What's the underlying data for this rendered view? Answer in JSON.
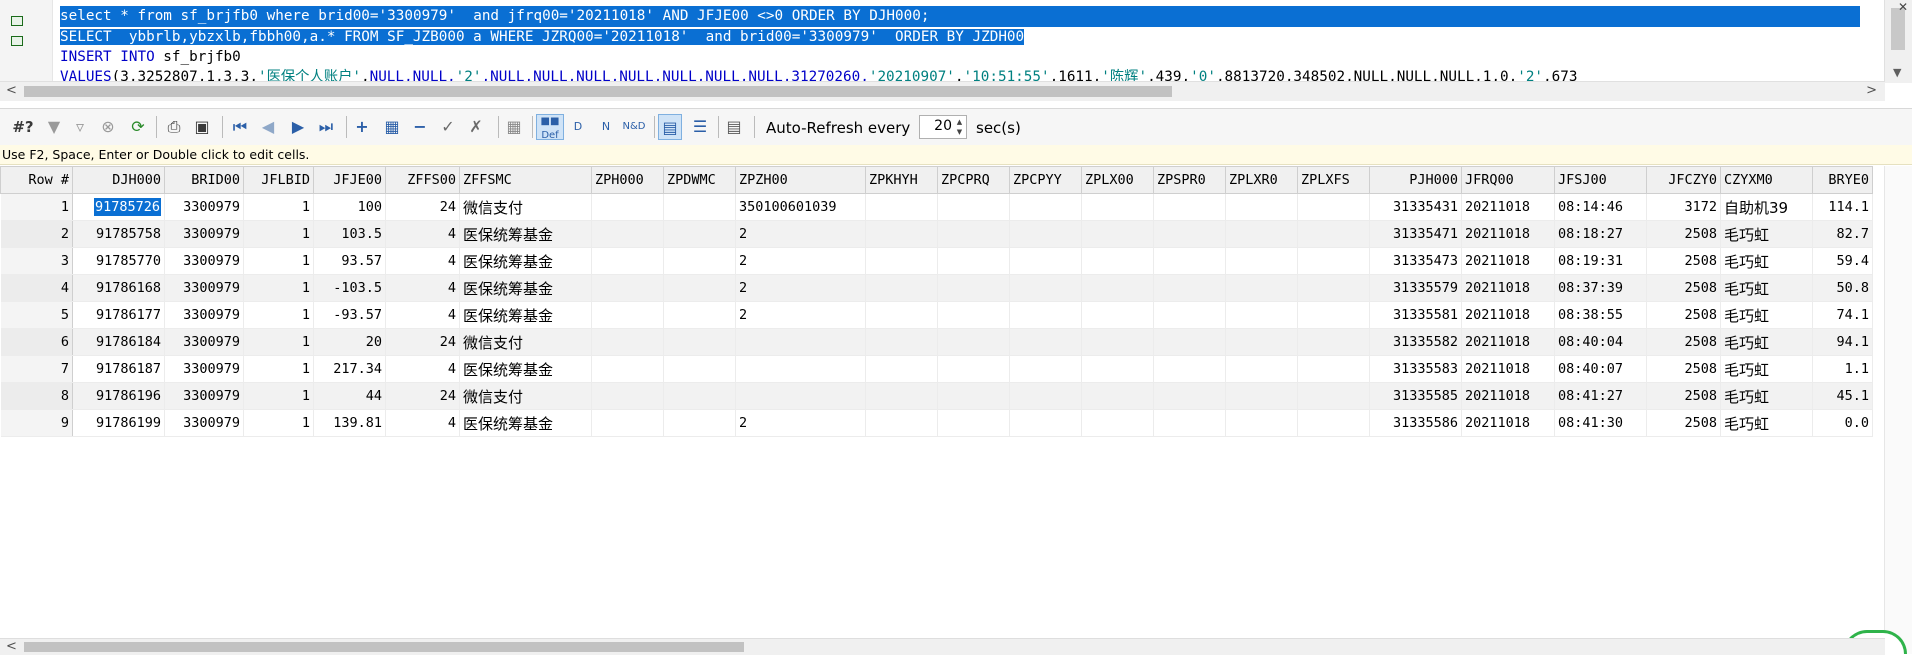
{
  "editor": {
    "line1": {
      "kw1": "select",
      "t1": " * ",
      "kw2": "from",
      "t2": " sf_brjfb0 ",
      "kw3": "where",
      "t3": " brid00=",
      "s1": "'3300979'",
      "t4": "  ",
      "kw4": "and",
      "t5": " jfrq00=",
      "s2": "'20211018'",
      "t6": " ",
      "kw5": "AND",
      "t7": " JFJE00 <>0 ",
      "kw6": "ORDER BY",
      "t8": " DJH000;"
    },
    "line2": {
      "kw1": "SELECT",
      "t1": "  ybbrlb,ybzxlb,fbbh00,a.* ",
      "kw2": "FROM",
      "t2": " SF_JZB000 a ",
      "kw3": "WHERE",
      "t3": " JZRQ00=",
      "s1": "'20211018'",
      "t4": "  ",
      "kw4": "and",
      "t5": " brid00=",
      "s2": "'3300979'",
      "t6": "  ",
      "kw5": "ORDER BY",
      "t7": " JZDH00"
    },
    "line3": {
      "kw1": "INSERT INTO",
      "t1": " sf_brjfb0"
    },
    "line4": {
      "kw1": "VALUES",
      "t1": "(3,3252807,1,3,3,",
      "s1": "'医保个人账户'",
      "t2": ",",
      "n1": "NULL,NULL,",
      "s2": "'2'",
      "t3": ",NULL,NULL,NULL,NULL,NULL,NULL,NULL,31270260,",
      "s3": "'20210907'",
      "t4": ",",
      "s4": "'10:51:55'",
      "t5": ",1611,",
      "s5": "'陈辉'",
      "t6": ",439,",
      "s6": "'0'",
      "t7": ",8813720,348502,NULL,NULL,NULL,1,0,",
      "s7": "'2'",
      "t8": ",673"
    }
  },
  "toolbar": {
    "rownum_icon": "#?",
    "auto_refresh_label": "Auto-Refresh every",
    "refresh_interval": "20",
    "secs_label": "sec(s)",
    "def_label": "Def",
    "icons": [
      "filter-icon",
      "filter-clear-icon",
      "cancel-icon",
      "refresh-icon",
      "print-icon",
      "save-icon",
      "first-record-icon",
      "prior-record-icon",
      "next-record-icon",
      "last-record-icon",
      "insert-record-icon",
      "duplicate-record-icon",
      "delete-record-icon",
      "post-edit-icon",
      "cancel-edit-icon",
      "grid-view-icon",
      "null-display-icon",
      "default-display-icon",
      "null-display-icon",
      "text-display-icon",
      "grid-mode-icon",
      "tree-mode-icon",
      "record-view-icon"
    ]
  },
  "hint": "Use F2, Space, Enter or Double click to edit cells.",
  "grid": {
    "columns": [
      "Row #",
      "DJH000",
      "BRID00",
      "JFLBID",
      "JFJE00",
      "ZFFS00",
      "ZFFSMC",
      "ZPH000",
      "ZPDWMC",
      "ZPZH00",
      "ZPKHYH",
      "ZPCPRQ",
      "ZPCPYY",
      "ZPLX00",
      "ZPSPR0",
      "ZPLXR0",
      "ZPLXFS",
      "PJH000",
      "JFRQ00",
      "JFSJ00",
      "JFCZY0",
      "CZYXM0",
      "BRYE0"
    ],
    "rows": [
      [
        "1",
        "91785726",
        "3300979",
        "1",
        "100",
        "24",
        "微信支付",
        "",
        "",
        "350100601039",
        "",
        "",
        "",
        "",
        "",
        "",
        "",
        "31335431",
        "20211018",
        "08:14:46",
        "3172",
        "自助机39",
        "114.1"
      ],
      [
        "2",
        "91785758",
        "3300979",
        "1",
        "103.5",
        "4",
        "医保统筹基金",
        "",
        "",
        "2",
        "",
        "",
        "",
        "",
        "",
        "",
        "",
        "31335471",
        "20211018",
        "08:18:27",
        "2508",
        "毛巧虹",
        "82.7"
      ],
      [
        "3",
        "91785770",
        "3300979",
        "1",
        "93.57",
        "4",
        "医保统筹基金",
        "",
        "",
        "2",
        "",
        "",
        "",
        "",
        "",
        "",
        "",
        "31335473",
        "20211018",
        "08:19:31",
        "2508",
        "毛巧虹",
        "59.4"
      ],
      [
        "4",
        "91786168",
        "3300979",
        "1",
        "-103.5",
        "4",
        "医保统筹基金",
        "",
        "",
        "2",
        "",
        "",
        "",
        "",
        "",
        "",
        "",
        "31335579",
        "20211018",
        "08:37:39",
        "2508",
        "毛巧虹",
        "50.8"
      ],
      [
        "5",
        "91786177",
        "3300979",
        "1",
        "-93.57",
        "4",
        "医保统筹基金",
        "",
        "",
        "2",
        "",
        "",
        "",
        "",
        "",
        "",
        "",
        "31335581",
        "20211018",
        "08:38:55",
        "2508",
        "毛巧虹",
        "74.1"
      ],
      [
        "6",
        "91786184",
        "3300979",
        "1",
        "20",
        "24",
        "微信支付",
        "",
        "",
        "",
        "",
        "",
        "",
        "",
        "",
        "",
        "",
        "31335582",
        "20211018",
        "08:40:04",
        "2508",
        "毛巧虹",
        "94.1"
      ],
      [
        "7",
        "91786187",
        "3300979",
        "1",
        "217.34",
        "4",
        "医保统筹基金",
        "",
        "",
        "",
        "",
        "",
        "",
        "",
        "",
        "",
        "",
        "31335583",
        "20211018",
        "08:40:07",
        "2508",
        "毛巧虹",
        "1.1"
      ],
      [
        "8",
        "91786196",
        "3300979",
        "1",
        "44",
        "24",
        "微信支付",
        "",
        "",
        "",
        "",
        "",
        "",
        "",
        "",
        "",
        "",
        "31335585",
        "20211018",
        "08:41:27",
        "2508",
        "毛巧虹",
        "45.1"
      ],
      [
        "9",
        "91786199",
        "3300979",
        "1",
        "139.81",
        "4",
        "医保统筹基金",
        "",
        "",
        "2",
        "",
        "",
        "",
        "",
        "",
        "",
        "",
        "31335586",
        "20211018",
        "08:41:30",
        "2508",
        "毛巧虹",
        "0.0"
      ]
    ]
  },
  "colors": {
    "selection": "#0a6fd3",
    "keyword": "#0000c8",
    "string": "#008080",
    "hint_bg": "#fffbe6"
  }
}
